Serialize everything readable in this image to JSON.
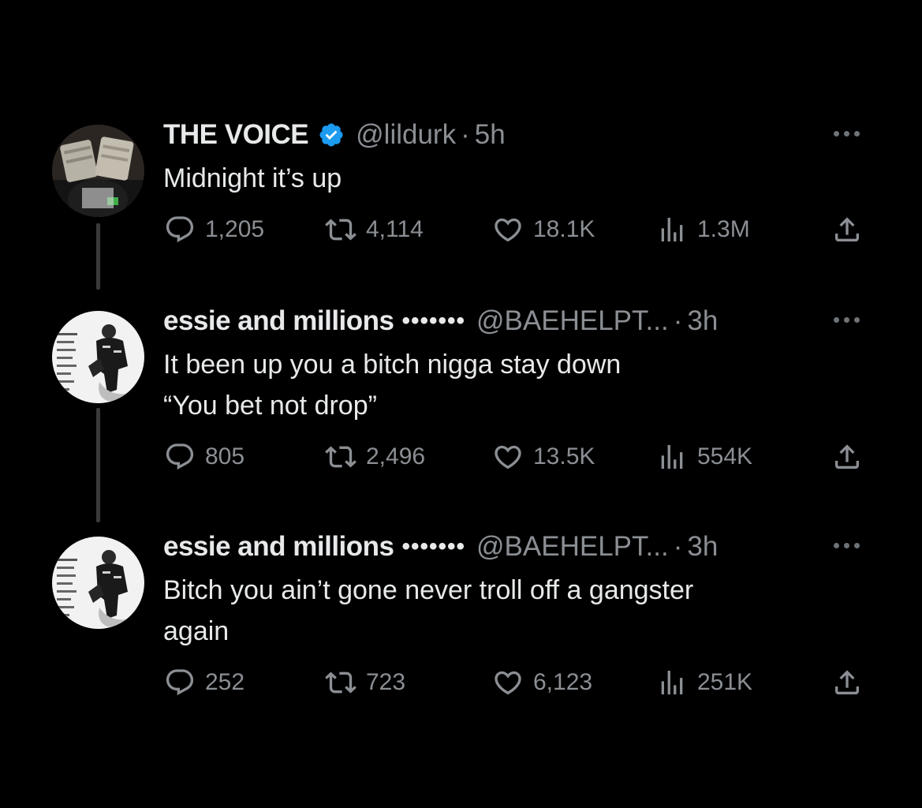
{
  "tweets": [
    {
      "name": "THE VOICE",
      "verified": true,
      "name_suffix": "",
      "handle": "@lildurk",
      "separator": "·",
      "time": "5h",
      "text": "Midnight it’s up",
      "stats": {
        "replies": "1,205",
        "reposts": "4,114",
        "likes": "18.1K",
        "views": "1.3M"
      }
    },
    {
      "name": "essie and millions",
      "verified": false,
      "name_suffix": "•••••••",
      "handle": "@BAEHELPT...",
      "separator": "·",
      "time": "3h",
      "text": "It been up you a bitch nigga stay down\n “You bet not drop”",
      "stats": {
        "replies": "805",
        "reposts": "2,496",
        "likes": "13.5K",
        "views": "554K"
      }
    },
    {
      "name": "essie and millions",
      "verified": false,
      "name_suffix": "•••••••",
      "handle": "@BAEHELPT...",
      "separator": "·",
      "time": "3h",
      "text": "Bitch you ain’t gone never troll off a gangster\nagain",
      "stats": {
        "replies": "252",
        "reposts": "723",
        "likes": "6,123",
        "views": "251K"
      }
    }
  ],
  "colors": {
    "background": "#000000",
    "primary_text": "#e7e9ea",
    "secondary_text": "#8b8f94",
    "verified_badge": "#1d9bf0",
    "thread_line": "#3a3a3a"
  },
  "icons": [
    "reply-icon",
    "repost-icon",
    "like-icon",
    "views-icon",
    "share-icon",
    "more-icon",
    "verified-badge-icon"
  ]
}
